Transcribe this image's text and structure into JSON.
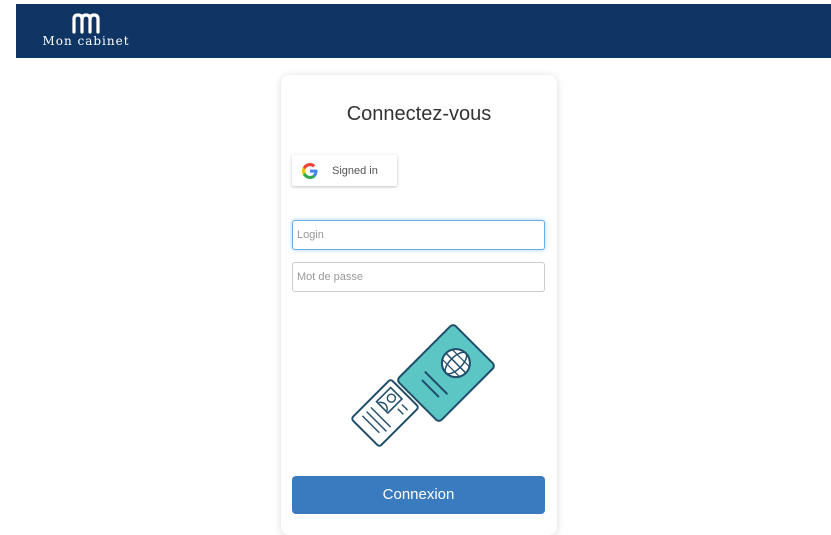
{
  "header": {
    "brand_name": "Mon cabinet",
    "logo_icon": "m-logo-icon",
    "background": "#0f3564"
  },
  "login": {
    "title": "Connectez-vous",
    "google_button_label": "Signed in",
    "login_placeholder": "Login",
    "password_placeholder": "Mot de passe",
    "submit_label": "Connexion",
    "accent": "#3a7bbf",
    "illustration": "passport-and-id-card-icon"
  }
}
